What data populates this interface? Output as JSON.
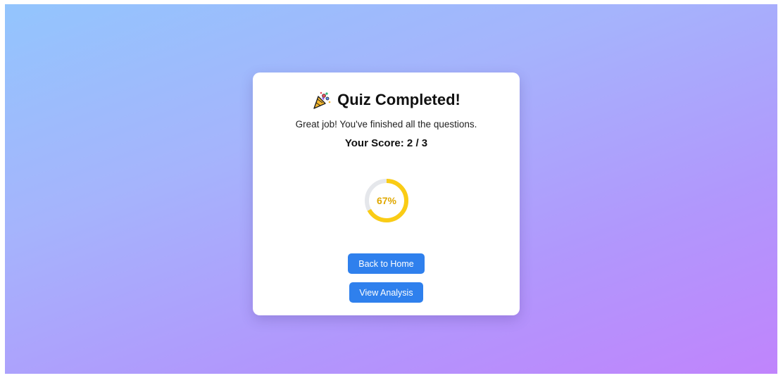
{
  "result_card": {
    "title": "Quiz Completed!",
    "title_icon": "party-popper-icon",
    "message": "Great job! You've finished all the questions.",
    "score_text": "Your Score: 2 / 3",
    "score": {
      "correct": 2,
      "total": 3
    },
    "progress_ring": {
      "percent": 67,
      "label": "67%",
      "fill_color": "#facc15",
      "track_color": "#e5e7eb"
    }
  },
  "buttons": {
    "back_home_label": "Back to Home",
    "view_analysis_label": "View Analysis",
    "color": "#2f80ed"
  },
  "background": {
    "gradient_start": "#93c5fd",
    "gradient_end": "#c084fc"
  }
}
